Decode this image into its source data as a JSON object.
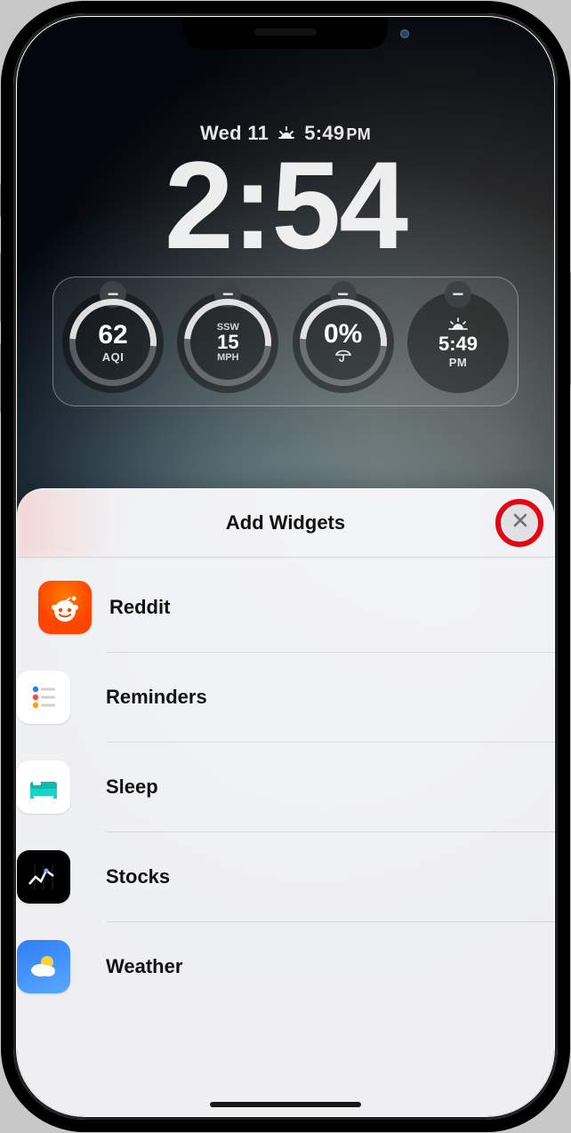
{
  "lockscreen": {
    "date": "Wed 11",
    "sunset_time": "5:49",
    "sunset_suffix": "PM",
    "time": "2:54"
  },
  "widgets": [
    {
      "id": "aqi",
      "line_top": "",
      "value": "62",
      "line_bottom": "AQI",
      "ring": true
    },
    {
      "id": "wind",
      "line_top": "SSW",
      "value": "15",
      "line_bottom": "MPH",
      "ring": true
    },
    {
      "id": "precip",
      "line_top": "",
      "value": "0%",
      "line_bottom": "",
      "ring": true,
      "icon": "umbrella"
    },
    {
      "id": "sunset",
      "line_top": "",
      "value": "5:49",
      "line_bottom": "PM",
      "ring": false,
      "icon": "sunset"
    }
  ],
  "sheet": {
    "title": "Add Widgets",
    "items": [
      {
        "id": "reddit",
        "label": "Reddit"
      },
      {
        "id": "reminders",
        "label": "Reminders"
      },
      {
        "id": "sleep",
        "label": "Sleep"
      },
      {
        "id": "stocks",
        "label": "Stocks"
      },
      {
        "id": "weather",
        "label": "Weather"
      }
    ]
  },
  "colors": {
    "highlight_ring": "#e30613"
  }
}
